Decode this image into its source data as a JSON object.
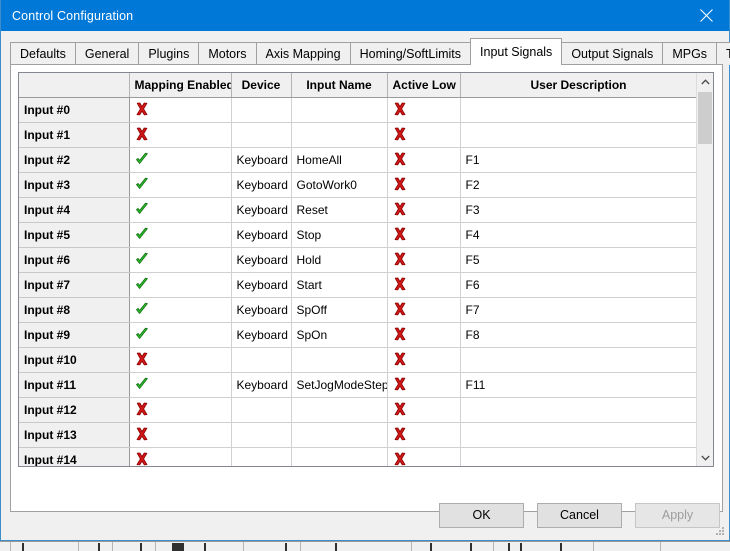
{
  "window": {
    "title": "Control Configuration",
    "close_icon": "close-icon"
  },
  "tabs": {
    "items": [
      {
        "label": "Defaults",
        "selected": false
      },
      {
        "label": "General",
        "selected": false
      },
      {
        "label": "Plugins",
        "selected": false
      },
      {
        "label": "Motors",
        "selected": false
      },
      {
        "label": "Axis Mapping",
        "selected": false
      },
      {
        "label": "Homing/SoftLimits",
        "selected": false
      },
      {
        "label": "Input Signals",
        "selected": true
      },
      {
        "label": "Output Signals",
        "selected": false
      },
      {
        "label": "MPGs",
        "selected": false
      },
      {
        "label": "Tools",
        "selected": false
      }
    ],
    "scroll_left_label": "◂",
    "scroll_right_label": "▸"
  },
  "grid": {
    "columns": [
      "",
      "Mapping Enabled",
      "Device",
      "Input Name",
      "Active Low",
      "User Description"
    ],
    "rows": [
      {
        "name": "Input #0",
        "mapping_enabled": "x",
        "device": "",
        "input_name": "",
        "active_low": "x",
        "user_description": ""
      },
      {
        "name": "Input #1",
        "mapping_enabled": "x",
        "device": "",
        "input_name": "",
        "active_low": "x",
        "user_description": ""
      },
      {
        "name": "Input #2",
        "mapping_enabled": "check",
        "device": "Keyboard",
        "input_name": "HomeAll",
        "active_low": "x",
        "user_description": "F1"
      },
      {
        "name": "Input #3",
        "mapping_enabled": "check",
        "device": "Keyboard",
        "input_name": "GotoWork0",
        "active_low": "x",
        "user_description": "F2"
      },
      {
        "name": "Input #4",
        "mapping_enabled": "check",
        "device": "Keyboard",
        "input_name": "Reset",
        "active_low": "x",
        "user_description": "F3"
      },
      {
        "name": "Input #5",
        "mapping_enabled": "check",
        "device": "Keyboard",
        "input_name": "Stop",
        "active_low": "x",
        "user_description": "F4"
      },
      {
        "name": "Input #6",
        "mapping_enabled": "check",
        "device": "Keyboard",
        "input_name": "Hold",
        "active_low": "x",
        "user_description": "F5"
      },
      {
        "name": "Input #7",
        "mapping_enabled": "check",
        "device": "Keyboard",
        "input_name": "Start",
        "active_low": "x",
        "user_description": "F6"
      },
      {
        "name": "Input #8",
        "mapping_enabled": "check",
        "device": "Keyboard",
        "input_name": "SpOff",
        "active_low": "x",
        "user_description": "F7"
      },
      {
        "name": "Input #9",
        "mapping_enabled": "check",
        "device": "Keyboard",
        "input_name": "SpOn",
        "active_low": "x",
        "user_description": "F8"
      },
      {
        "name": "Input #10",
        "mapping_enabled": "x",
        "device": "",
        "input_name": "",
        "active_low": "x",
        "user_description": ""
      },
      {
        "name": "Input #11",
        "mapping_enabled": "check",
        "device": "Keyboard",
        "input_name": "SetJogModeStep",
        "active_low": "x",
        "user_description": "F11"
      },
      {
        "name": "Input #12",
        "mapping_enabled": "x",
        "device": "",
        "input_name": "",
        "active_low": "x",
        "user_description": ""
      },
      {
        "name": "Input #13",
        "mapping_enabled": "x",
        "device": "",
        "input_name": "",
        "active_low": "x",
        "user_description": ""
      },
      {
        "name": "Input #14",
        "mapping_enabled": "x",
        "device": "",
        "input_name": "",
        "active_low": "x",
        "user_description": ""
      }
    ],
    "scrollbar": {
      "up_icon": "chevron-up-icon",
      "down_icon": "chevron-down-icon"
    }
  },
  "buttons": {
    "ok": "OK",
    "cancel": "Cancel",
    "apply": "Apply",
    "apply_disabled": true
  },
  "colors": {
    "titlebar": "#0078d7",
    "dialog_bg": "#f0f0f0",
    "check_green": "#22a022",
    "x_red": "#cc1111",
    "accent_border": "#3e8ecb"
  }
}
